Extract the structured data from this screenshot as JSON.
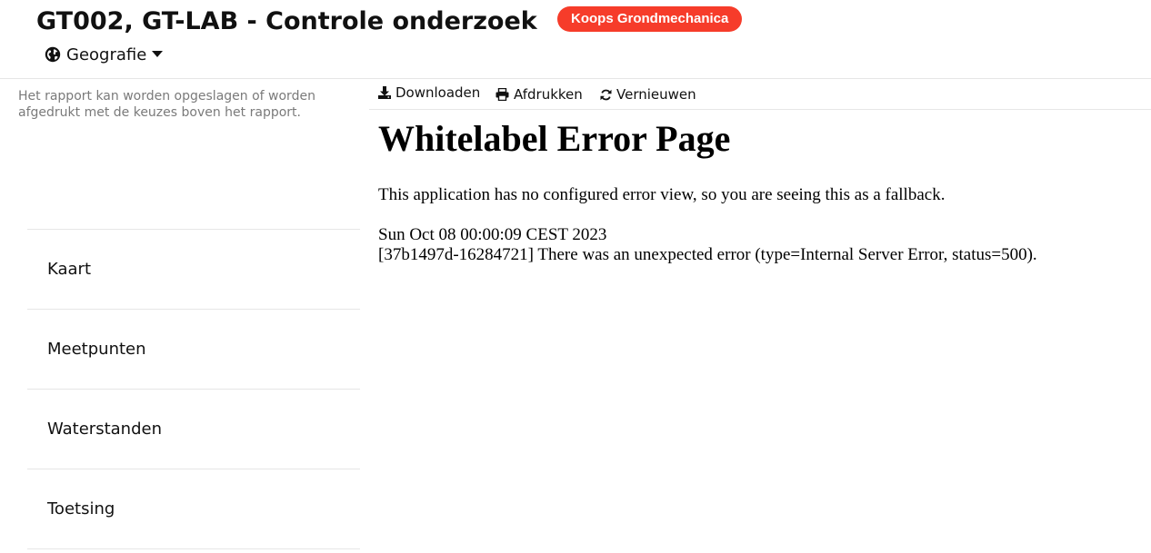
{
  "header": {
    "title": "GT002, GT-LAB - Controle onderzoek",
    "badge": "Koops Grondmechanica",
    "badge_color": "#f63c2a",
    "geo_label": "Geografie",
    "geo_icon": "globe-icon",
    "geo_caret_icon": "caret-down-icon"
  },
  "sidebar": {
    "note": "Het rapport kan worden opgeslagen of worden afgedrukt met de keuzes boven het rapport.",
    "items": [
      {
        "label": "Kaart"
      },
      {
        "label": "Meetpunten"
      },
      {
        "label": "Waterstanden"
      },
      {
        "label": "Toetsing"
      }
    ]
  },
  "toolbar": {
    "download_label": "Downloaden",
    "download_icon": "download-icon",
    "print_label": "Afdrukken",
    "print_icon": "print-icon",
    "refresh_label": "Vernieuwen",
    "refresh_icon": "refresh-icon"
  },
  "error": {
    "title": "Whitelabel Error Page",
    "message": "This application has no configured error view, so you are seeing this as a fallback.",
    "timestamp": "Sun Oct 08 00:00:09 CEST 2023",
    "detail": "[37b1497d-16284721] There was an unexpected error (type=Internal Server Error, status=500)."
  }
}
